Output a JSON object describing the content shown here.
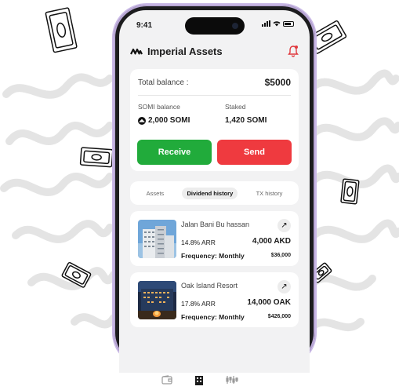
{
  "status": {
    "time": "9:41"
  },
  "header": {
    "title": "Imperial Assets"
  },
  "balance": {
    "total_label": "Total balance :",
    "total_value": "$5000",
    "somi_label": "SOMI balance",
    "somi_value": "2,000 SOMI",
    "staked_label": "Staked",
    "staked_value": "1,420 SOMI",
    "receive_label": "Receive",
    "send_label": "Send"
  },
  "tabs": [
    {
      "label": "Assets",
      "active": false
    },
    {
      "label": "Dividend history",
      "active": true
    },
    {
      "label": "TX history",
      "active": false
    }
  ],
  "assets": [
    {
      "name": "Jalan Bani Bu hassan",
      "arr": "14.8% ARR",
      "amount": "4,000 AKD",
      "frequency": "Frequency: Monthly",
      "usd": "$36,000"
    },
    {
      "name": "Oak Island Resort",
      "arr": "17.8% ARR",
      "amount": "14,000 OAK",
      "frequency": "Frequency: Monthly",
      "usd": "$426,000"
    }
  ],
  "bottom_nav": [
    {
      "icon": "wallet-icon"
    },
    {
      "icon": "building-icon"
    },
    {
      "icon": "chart-icon"
    }
  ],
  "colors": {
    "receive": "#21ab3b",
    "send": "#ef3a3f",
    "bell": "#e0393e",
    "frame": "#c9b8e6"
  }
}
